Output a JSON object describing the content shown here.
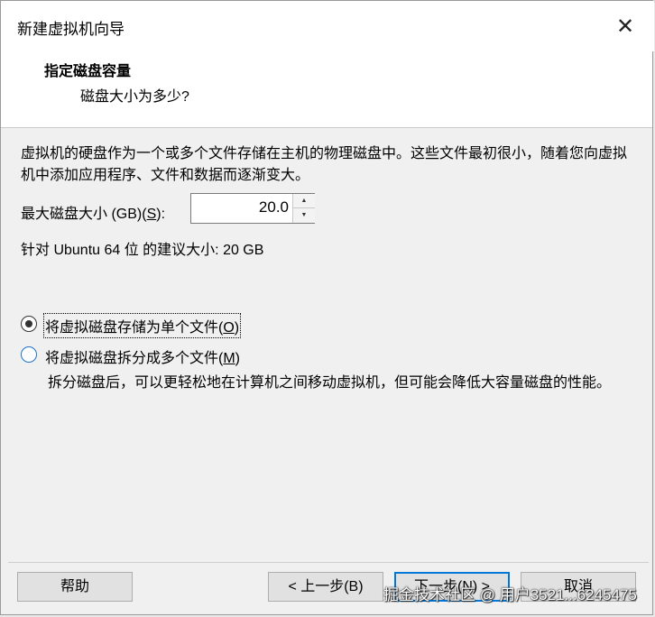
{
  "window": {
    "title": "新建虚拟机向导",
    "close_glyph": "✕"
  },
  "header": {
    "title": "指定磁盘容量",
    "subtitle": "磁盘大小为多少?"
  },
  "body": {
    "description": "虚拟机的硬盘作为一个或多个文件存储在主机的物理磁盘中。这些文件最初很小，随着您向虚拟机中添加应用程序、文件和数据而逐渐变大。",
    "size_label_prefix": "最大磁盘大小 (GB)(",
    "size_label_key": "S",
    "size_label_suffix": "):",
    "size_value": "20.0",
    "recommendation": "针对 Ubuntu 64 位 的建议大小: 20 GB"
  },
  "options": {
    "single_file": {
      "label_prefix": "将虚拟磁盘存储为单个文件(",
      "key": "O",
      "label_suffix": ")",
      "selected": true
    },
    "multiple_files": {
      "label_prefix": "将虚拟磁盘拆分成多个文件(",
      "key": "M",
      "label_suffix": ")",
      "selected": false
    },
    "split_note": "拆分磁盘后，可以更轻松地在计算机之间移动虚拟机，但可能会降低大容量磁盘的性能。"
  },
  "buttons": {
    "help": "帮助",
    "back": "< 上一步(B)",
    "next": "下一步(N) >",
    "cancel": "取消"
  },
  "watermark": "掘金技术社区 @ 用户3521...6245475",
  "colors": {
    "radio_accent": "#1d72c9",
    "default_button_border": "#0078d7"
  }
}
